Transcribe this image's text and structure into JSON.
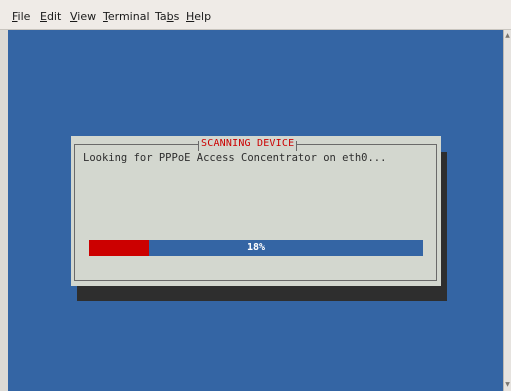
{
  "menu": [
    {
      "mnemonic": "F",
      "rest": "ile"
    },
    {
      "mnemonic": "E",
      "rest": "dit"
    },
    {
      "mnemonic": "V",
      "rest": "iew"
    },
    {
      "mnemonic": "T",
      "rest": "erminal"
    },
    {
      "pre": "Ta",
      "mnemonic": "b",
      "rest": "s"
    },
    {
      "mnemonic": "H",
      "rest": "elp"
    }
  ],
  "dialog": {
    "title": "SCANNING DEVICE",
    "message": "Looking for PPPoE Access Concentrator on eth0...",
    "progress_label": "18%",
    "progress_fraction": 0.18
  },
  "colors": {
    "terminal_bg": "#3465a4",
    "dialog_bg": "#d3d7cf",
    "title_text": "#cc0000",
    "progress_fill": "#cc0000",
    "shadow": "#2e2e2e"
  },
  "icons": {
    "scroll_up": "arrow-up-icon",
    "scroll_down": "arrow-down-icon"
  }
}
